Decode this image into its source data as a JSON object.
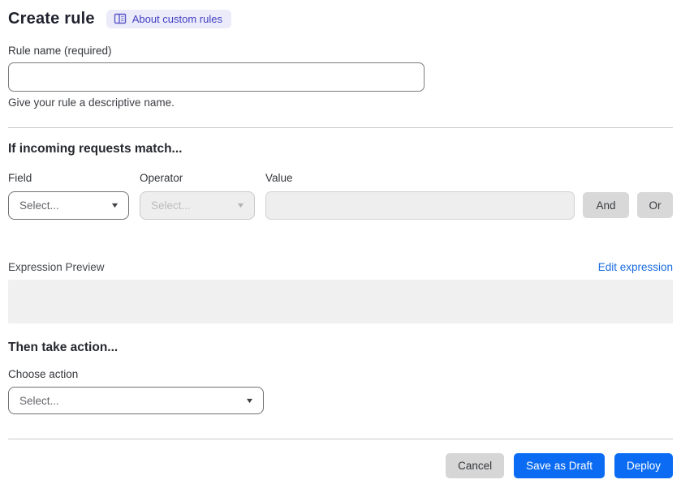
{
  "header": {
    "title": "Create rule",
    "about_badge_label": "About custom rules"
  },
  "rule_name": {
    "label": "Rule name (required)",
    "value": "",
    "placeholder": "",
    "helper": "Give your rule a descriptive name."
  },
  "match_section": {
    "heading": "If incoming requests match...",
    "field": {
      "label": "Field",
      "selected": "Select..."
    },
    "operator": {
      "label": "Operator",
      "selected": "Select...",
      "disabled": true
    },
    "value": {
      "label": "Value",
      "value": "",
      "disabled": true
    },
    "and_button": "And",
    "or_button": "Or"
  },
  "expression": {
    "preview_label": "Expression Preview",
    "edit_link": "Edit expression",
    "preview_value": ""
  },
  "action_section": {
    "heading": "Then take action...",
    "choose_label": "Choose action",
    "selected": "Select..."
  },
  "footer": {
    "cancel": "Cancel",
    "save_draft": "Save as Draft",
    "deploy": "Deploy"
  },
  "icons": {
    "caret": "▼",
    "about_icon": "book-icon"
  },
  "colors": {
    "primary_blue": "#0b6cf3",
    "link_blue": "#1a6ce0",
    "badge_bg": "#ecebfa",
    "badge_text": "#4140c4",
    "disabled_bg": "#eeeeee",
    "neutral_button_bg": "#d8d8d8"
  }
}
